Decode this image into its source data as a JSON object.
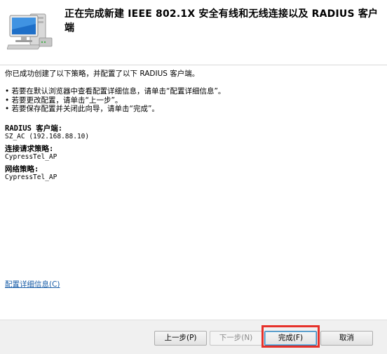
{
  "header": {
    "title": "正在完成新建 IEEE 802.1X 安全有线和无线连接以及 RADIUS 客户端",
    "icon": "computer-network-icon"
  },
  "content": {
    "intro": "你已成功创建了以下策略，并配置了以下 RADIUS 客户端。",
    "bullets": [
      "• 若要在默认浏览器中查看配置详细信息，请单击“配置详细信息”。",
      "• 若要更改配置，请单击“上一步”。",
      "• 若要保存配置并关闭此向导，请单击“完成”。"
    ],
    "details": [
      {
        "label": "RADIUS 客户端:",
        "value": "SZ_AC (192.168.88.10)"
      },
      {
        "label": "连接请求策略:",
        "value": "CypressTel_AP"
      },
      {
        "label": "网络策略:",
        "value": "CypressTel_AP"
      }
    ],
    "details_link": "配置详细信息(C)"
  },
  "footer": {
    "back_label": "上一步(P)",
    "next_label": "下一步(N)",
    "finish_label": "完成(F)",
    "cancel_label": "取消"
  },
  "colors": {
    "link": "#1a5ea8",
    "highlight": "#e6312a"
  }
}
